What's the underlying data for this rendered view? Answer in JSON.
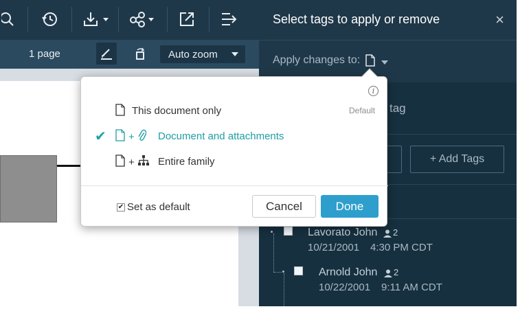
{
  "toolbar": {
    "icons": [
      "search-icon",
      "history-icon",
      "download-icon",
      "share-icon",
      "open-external-icon",
      "export-icon"
    ]
  },
  "toolbar2": {
    "page_count": "1 page",
    "zoom": "Auto zoom"
  },
  "panel": {
    "title": "Select tags to apply or remove",
    "close": "×",
    "apply_label": "Apply changes to:",
    "tag_text": "tag",
    "add_tags": "+ Add Tags",
    "entries": [
      {
        "name": "Lavorato John",
        "count": "2",
        "date": "10/21/2001",
        "time": "4:30 PM CDT"
      },
      {
        "name": "Arnold John",
        "count": "2",
        "date": "10/22/2001",
        "time": "9:11 AM CDT"
      }
    ]
  },
  "popup": {
    "info": "i",
    "options": [
      {
        "label": "This document only",
        "selected": false,
        "tag": "Default"
      },
      {
        "label": "Document and attachments",
        "selected": true
      },
      {
        "label": "Entire family",
        "selected": false
      }
    ],
    "plus": "+",
    "checkmark": "✔",
    "set_default": "Set as default",
    "set_default_checked": true,
    "cancel": "Cancel",
    "done": "Done"
  },
  "colors": {
    "panel_bg": "#17303f",
    "toolbar_bg": "#1f3849",
    "accent": "#1f9ea4",
    "done_button": "#2e9fcc"
  }
}
